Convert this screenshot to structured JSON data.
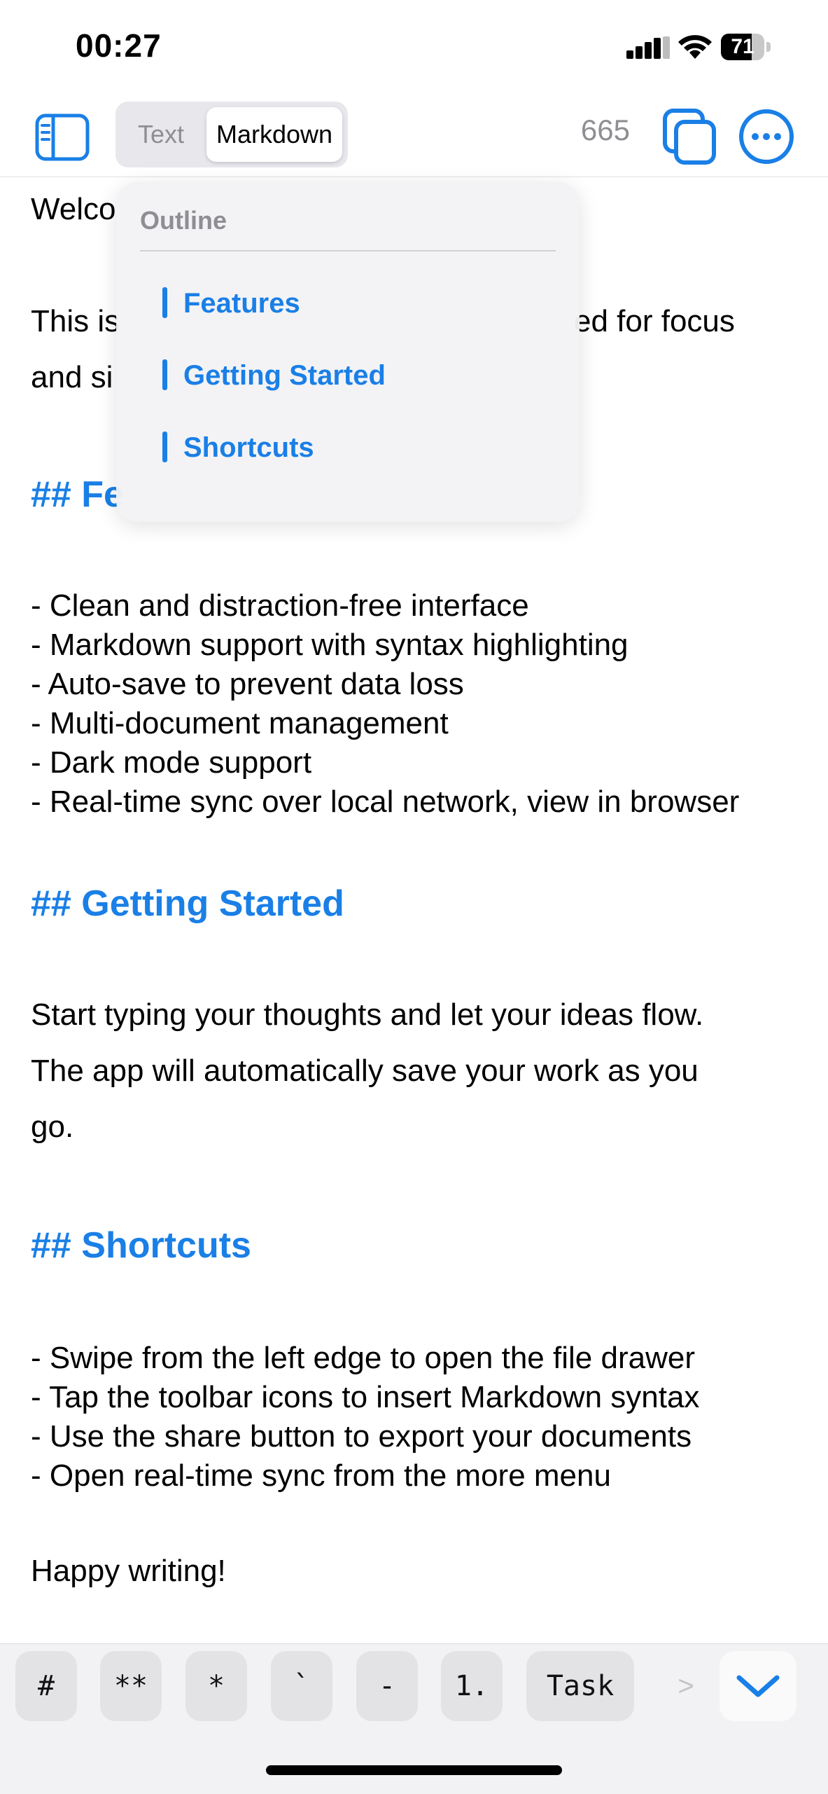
{
  "status_bar": {
    "time": "00:27",
    "battery": "71",
    "battery_level_percent": 71,
    "icons": [
      "cellular-signal-icon",
      "wifi-icon",
      "battery-icon"
    ]
  },
  "toolbar": {
    "sidebar_icon": "sidebar-icon",
    "segments": {
      "text": "Text",
      "markdown": "Markdown",
      "selected": "Markdown"
    },
    "word_count": "665",
    "copy_icon": "copy-icon",
    "more_icon": "ellipsis-circle-icon"
  },
  "outline": {
    "title": "Outline",
    "items": [
      {
        "label": "Features"
      },
      {
        "label": "Getting Started"
      },
      {
        "label": "Shortcuts"
      }
    ]
  },
  "editor": {
    "welcome_partial": "Welco",
    "intro_partial_left": "This is",
    "intro_partial_right": "ed for focus",
    "intro_line2_partial": "and si",
    "features_heading_partial": "## Fe",
    "features_list": [
      "- Clean and distraction-free interface",
      "- Markdown support with syntax highlighting",
      "- Auto-save to prevent data loss",
      "- Multi-document management",
      "- Dark mode support",
      "- Real-time sync over local network, view in browser"
    ],
    "getting_started_heading": "## Getting Started",
    "getting_started_lines": [
      "Start typing your thoughts and let your ideas flow.",
      "The app will automatically save your work as you",
      "go."
    ],
    "shortcuts_heading": "## Shortcuts",
    "shortcuts_list": [
      "- Swipe from the left edge to open the file drawer",
      "- Tap the toolbar icons to insert Markdown syntax",
      "- Use the share button to export your documents",
      "- Open real-time sync from the more menu"
    ],
    "closing": "Happy writing!"
  },
  "keybar": {
    "keys": [
      "#",
      "**",
      "*",
      "`",
      "-",
      "1.",
      "Task"
    ],
    "more": ">",
    "dismiss_icon": "chevron-down-icon"
  },
  "colors": {
    "accent": "#1a7fe6",
    "muted": "#8e8e93"
  }
}
